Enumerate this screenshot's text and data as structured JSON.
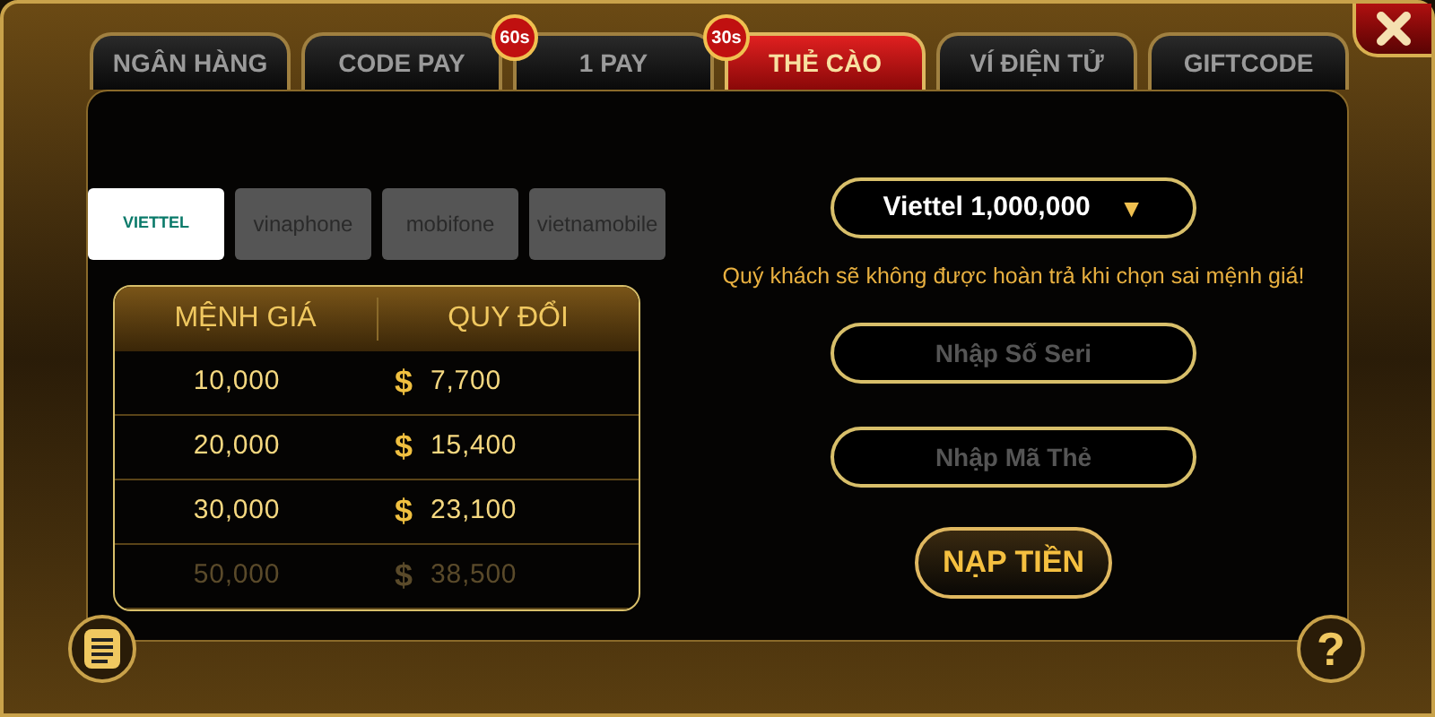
{
  "tabs": [
    {
      "label": "NGÂN HÀNG",
      "selected": false
    },
    {
      "label": "CODE PAY",
      "selected": false,
      "badge": "60s"
    },
    {
      "label": "1 PAY",
      "selected": false,
      "badge": "30s"
    },
    {
      "label": "THẺ CÀO",
      "selected": true
    },
    {
      "label": "VÍ ĐIỆN TỬ",
      "selected": false
    },
    {
      "label": "GIFTCODE",
      "selected": false
    }
  ],
  "carriers": [
    {
      "label": "VIETTEL",
      "selected": true
    },
    {
      "label": "vinaphone",
      "selected": false
    },
    {
      "label": "mobifone",
      "selected": false
    },
    {
      "label": "vietnamobile",
      "selected": false
    }
  ],
  "rate_table": {
    "columns": [
      "MỆNH GIÁ",
      "QUY ĐỔI"
    ],
    "rows": [
      {
        "value": "10,000",
        "currency": "$",
        "converted": "7,700",
        "faded": false
      },
      {
        "value": "20,000",
        "currency": "$",
        "converted": "15,400",
        "faded": false
      },
      {
        "value": "30,000",
        "currency": "$",
        "converted": "23,100",
        "faded": false
      },
      {
        "value": "50,000",
        "currency": "$",
        "converted": "38,500",
        "faded": true
      }
    ]
  },
  "amount_dropdown": {
    "value": "Viettel 1,000,000",
    "caret": "▼"
  },
  "warning": "Quý khách sẽ không được hoàn trả khi chọn sai mệnh giá!",
  "serial_field": {
    "placeholder": "Nhập Số Seri"
  },
  "code_field": {
    "placeholder": "Nhập Mã Thẻ"
  },
  "submit_button": "NẠP TIỀN",
  "help_button": "?"
}
